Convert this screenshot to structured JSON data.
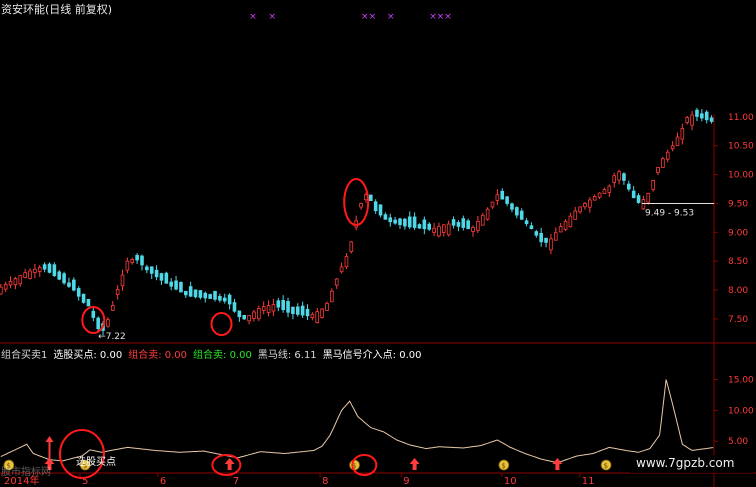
{
  "window": {
    "title": "资安环能(日线 前复权)"
  },
  "colors": {
    "up": "#ff3b3b",
    "down": "#4fd8e8",
    "frame": "#8b0000",
    "axis_text": "#ff3b3b",
    "indicator_line": "#e9c9a8",
    "annotation_circle": "#ff1a1a",
    "magenta_marks": "#d040ff",
    "bg": "#000000"
  },
  "indicator_header": [
    {
      "text": "组合买卖1",
      "color": "#d8d8d8"
    },
    {
      "text": "选股买点: 0.00",
      "color": "#ffffff"
    },
    {
      "text": "组合卖: 0.00",
      "color": "#ff3b3b"
    },
    {
      "text": "组合卖: 0.00",
      "color": "#29e629"
    },
    {
      "text": "黑马线: 6.11",
      "color": "#d8d8d8"
    },
    {
      "text": "黑马信号介入点: 0.00",
      "color": "#ffffff"
    }
  ],
  "annotations": {
    "low_price_label": "7.22",
    "price_box": "9.49 - 9.53",
    "buy_point_label": "选股买点",
    "watermark": "www.7gpzb.com",
    "faint_logo_text": "股市指标网"
  },
  "chart_data": [
    {
      "type": "candlestick",
      "title": "资安环能(日线 前复权)",
      "x_tick_labels": [
        "2014年",
        "5",
        "6",
        "7",
        "8",
        "9",
        "10",
        "11"
      ],
      "y_ticks": [
        7.5,
        8.0,
        8.5,
        9.0,
        9.5,
        10.0,
        10.5
      ],
      "y_top_partial_label": "11.00",
      "ylim": [
        7.1,
        11.05
      ],
      "price_marker": {
        "value": 9.5,
        "label": "9.49 - 9.53"
      },
      "low_marker": {
        "value": 7.22,
        "label": "7.22"
      },
      "close_anchor_points": [
        [
          0,
          8.05
        ],
        [
          15,
          8.3
        ],
        [
          25,
          8.4
        ],
        [
          33,
          8.25
        ],
        [
          45,
          8.0
        ],
        [
          52,
          7.75
        ],
        [
          56,
          7.7
        ],
        [
          58,
          7.35
        ],
        [
          63,
          7.3
        ],
        [
          67,
          7.55
        ],
        [
          73,
          8.1
        ],
        [
          78,
          8.5
        ],
        [
          83,
          8.55
        ],
        [
          90,
          8.35
        ],
        [
          100,
          8.15
        ],
        [
          115,
          7.9
        ],
        [
          130,
          7.85
        ],
        [
          140,
          7.8
        ],
        [
          146,
          7.55
        ],
        [
          150,
          7.5
        ],
        [
          160,
          7.7
        ],
        [
          168,
          7.75
        ],
        [
          178,
          7.6
        ],
        [
          190,
          7.55
        ],
        [
          200,
          7.7
        ],
        [
          210,
          8.4
        ],
        [
          215,
          8.7
        ],
        [
          218,
          9.1
        ],
        [
          222,
          9.5
        ],
        [
          226,
          9.7
        ],
        [
          230,
          9.4
        ],
        [
          238,
          9.2
        ],
        [
          250,
          9.1
        ],
        [
          265,
          9.05
        ],
        [
          275,
          9.15
        ],
        [
          290,
          9.05
        ],
        [
          300,
          9.4
        ],
        [
          306,
          9.65
        ],
        [
          312,
          9.5
        ],
        [
          318,
          9.3
        ],
        [
          326,
          9.1
        ],
        [
          334,
          8.8
        ],
        [
          338,
          8.85
        ],
        [
          345,
          9.1
        ],
        [
          355,
          9.4
        ],
        [
          365,
          9.6
        ],
        [
          375,
          9.8
        ],
        [
          380,
          10.1
        ],
        [
          386,
          9.8
        ],
        [
          392,
          9.5
        ],
        [
          398,
          9.6
        ],
        [
          406,
          10.2
        ],
        [
          414,
          10.5
        ],
        [
          420,
          10.8
        ],
        [
          424,
          11.05
        ],
        [
          430,
          11.0
        ],
        [
          440,
          10.9
        ]
      ],
      "green_bar_indices": [
        55,
        60,
        140,
        305,
        326,
        342
      ],
      "first_shown_index": 0,
      "last_shown_index": 439
    },
    {
      "type": "line",
      "title": "组合买卖1",
      "y_ticks": [
        5.0,
        10.0,
        15.0
      ],
      "ylim": [
        0.0,
        18.5
      ],
      "secondary_line_value": 6.11,
      "series_anchor_points": [
        [
          0,
          2.5
        ],
        [
          16,
          4.5
        ],
        [
          20,
          3.0
        ],
        [
          30,
          2.0
        ],
        [
          38,
          1.8
        ],
        [
          50,
          2.6
        ],
        [
          55,
          3.6
        ],
        [
          62,
          3.2
        ],
        [
          70,
          3.6
        ],
        [
          78,
          4.0
        ],
        [
          95,
          3.5
        ],
        [
          110,
          3.2
        ],
        [
          125,
          3.4
        ],
        [
          140,
          2.6
        ],
        [
          146,
          2.3
        ],
        [
          160,
          3.3
        ],
        [
          175,
          3.0
        ],
        [
          193,
          3.5
        ],
        [
          198,
          4.2
        ],
        [
          203,
          6.0
        ],
        [
          210,
          10.0
        ],
        [
          215,
          11.5
        ],
        [
          220,
          9.0
        ],
        [
          228,
          7.2
        ],
        [
          236,
          6.5
        ],
        [
          244,
          5.2
        ],
        [
          252,
          4.4
        ],
        [
          262,
          3.8
        ],
        [
          270,
          4.1
        ],
        [
          285,
          3.9
        ],
        [
          296,
          4.3
        ],
        [
          306,
          5.2
        ],
        [
          314,
          4.0
        ],
        [
          323,
          3.0
        ],
        [
          333,
          2.1
        ],
        [
          343,
          1.5
        ],
        [
          355,
          2.6
        ],
        [
          365,
          3.0
        ],
        [
          375,
          4.0
        ],
        [
          385,
          3.5
        ],
        [
          393,
          3.2
        ],
        [
          400,
          3.8
        ],
        [
          406,
          6.0
        ],
        [
          410,
          15.0
        ],
        [
          414,
          11.0
        ],
        [
          420,
          4.5
        ],
        [
          426,
          3.5
        ],
        [
          440,
          4.0
        ]
      ],
      "marker_positions": [
        {
          "kind": "money-bag",
          "index": 5
        },
        {
          "kind": "buy-arrow",
          "index": 30
        },
        {
          "kind": "money-bag",
          "index": 52
        },
        {
          "kind": "buy-arrow",
          "index": 141
        },
        {
          "kind": "money-bag",
          "index": 218
        },
        {
          "kind": "buy-arrow",
          "index": 255
        },
        {
          "kind": "money-bag",
          "index": 310
        },
        {
          "kind": "buy-arrow",
          "index": 343
        },
        {
          "kind": "money-bag",
          "index": 373
        }
      ]
    }
  ],
  "magenta_marks": [
    {
      "text": "×",
      "index": 153
    },
    {
      "text": "×",
      "index": 165
    },
    {
      "text": "××",
      "index": 222
    },
    {
      "text": "×",
      "index": 238
    },
    {
      "text": "×××",
      "index": 264
    }
  ],
  "circle_annotations": [
    {
      "target": "price-low-1",
      "index": 57
    },
    {
      "target": "price-low-2",
      "index": 136
    },
    {
      "target": "price-peak",
      "index": 219
    },
    {
      "target": "indicator-buy-1",
      "index": 50
    },
    {
      "target": "indicator-buy-2",
      "index": 139
    },
    {
      "target": "indicator-buy-3",
      "index": 224
    }
  ]
}
